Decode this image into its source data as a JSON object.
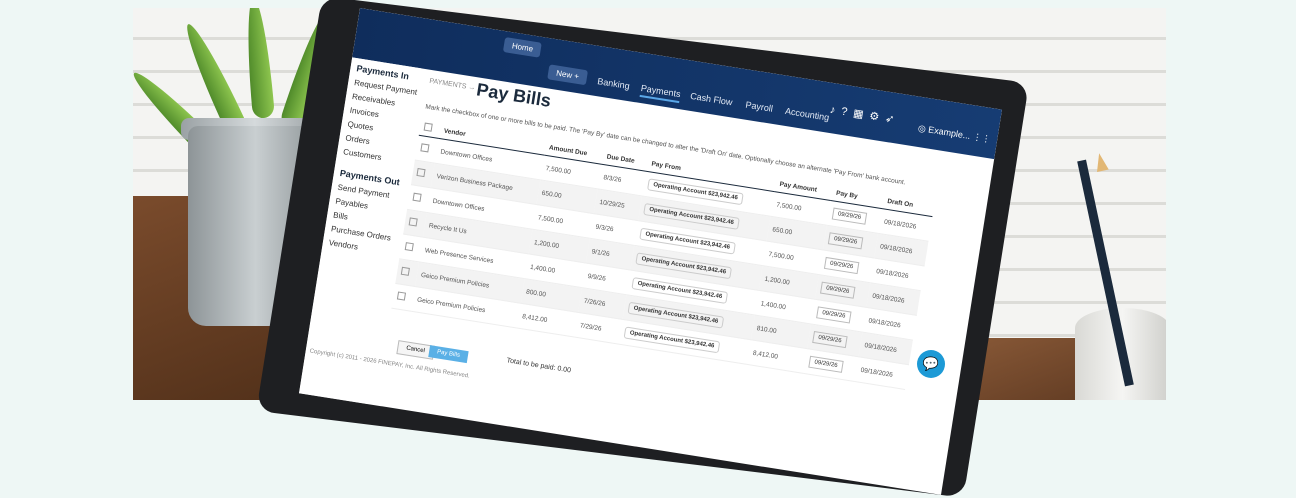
{
  "nav": {
    "home": "Home",
    "new": "New +",
    "tabs": [
      "Banking",
      "Payments",
      "Cash Flow",
      "Payroll",
      "Accounting"
    ],
    "user": "Example..."
  },
  "sidebar": {
    "payments_in": "Payments In",
    "in_items": [
      "Request Payment",
      "Receivables",
      "Invoices",
      "Quotes",
      "Orders",
      "Customers"
    ],
    "payments_out": "Payments Out",
    "out_items": [
      "Send Payment",
      "Payables",
      "Bills",
      "Purchase Orders",
      "Vendors"
    ]
  },
  "page": {
    "breadcrumb": "PAYMENTS →",
    "title": "Pay Bills",
    "hint": "Mark the checkbox of one or more bills to be paid. The 'Pay By' date can be changed to alter the 'Draft On' date. Optionally choose an alternate 'Pay From' bank account."
  },
  "table": {
    "headers": [
      "Vendor",
      "Amount Due",
      "Due Date",
      "Pay From",
      "Pay Amount",
      "Pay By",
      "Draft On"
    ],
    "rows": [
      [
        "Downtown Offices",
        "7,500.00",
        "8/3/26",
        "Operating Account $23,942.46",
        "7,500.00",
        "09/29/26",
        "09/18/2026"
      ],
      [
        "Verizon Business Package",
        "650.00",
        "10/29/25",
        "Operating Account $23,942.46",
        "650.00",
        "09/29/26",
        "09/18/2026"
      ],
      [
        "Downtown Offices",
        "7,500.00",
        "9/3/26",
        "Operating Account $23,942.46",
        "7,500.00",
        "09/29/26",
        "09/18/2026"
      ],
      [
        "Recycle It Us",
        "1,200.00",
        "9/1/26",
        "Operating Account $23,942.46",
        "1,200.00",
        "09/29/26",
        "09/18/2026"
      ],
      [
        "Web Presence Services",
        "1,400.00",
        "9/9/26",
        "Operating Account $23,942.46",
        "1,400.00",
        "09/29/26",
        "09/18/2026"
      ],
      [
        "Geico Premium Policies",
        "800.00",
        "7/26/26",
        "Operating Account $23,942.46",
        "810.00",
        "09/29/26",
        "09/18/2026"
      ],
      [
        "Geico Premium Policies",
        "8,412.00",
        "7/29/26",
        "Operating Account $23,942.46",
        "8,412.00",
        "09/29/26",
        "09/18/2026"
      ]
    ]
  },
  "footer": {
    "copyright": "Copyright (c) 2011 - 2026 FINEPAY, Inc. All Rights Reserved.",
    "cancel": "Cancel",
    "pay": "Pay Bills",
    "total": "Total to be paid: 0.00"
  }
}
